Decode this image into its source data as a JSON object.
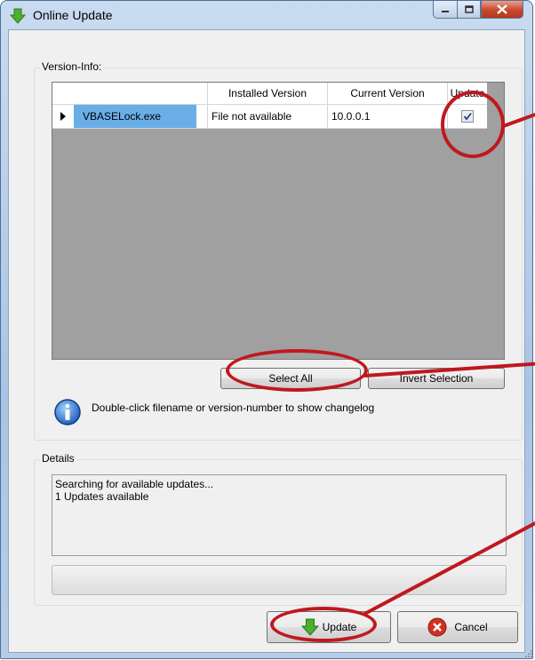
{
  "window": {
    "title": "Online Update",
    "title_icon": "green-down-arrow-icon",
    "caption_buttons": [
      "minimize-icon",
      "maximize-icon",
      "close-icon"
    ]
  },
  "version_info": {
    "group_label": "Version-Info:",
    "columns": [
      "Installed Version",
      "Current Version",
      "Update"
    ],
    "rows": [
      {
        "filename": "VBASELock.exe",
        "installed": "File not available",
        "current": "10.0.0.1",
        "update_checked": true
      }
    ],
    "buttons": {
      "select_all": "Select All",
      "invert_selection": "Invert Selection"
    },
    "hint": "Double-click filename or version-number to show changelog",
    "hint_icon": "info-icon"
  },
  "details": {
    "group_label": "Details",
    "log_lines": [
      "Searching for available updates...",
      "1 Updates available"
    ]
  },
  "footer": {
    "update_button": "Update",
    "update_icon": "green-down-arrow-icon",
    "cancel_button": "Cancel",
    "cancel_icon": "red-x-icon"
  },
  "colors": {
    "selection": "#6aaee8",
    "annotation": "#c0181f",
    "grid_background": "#a0a0a0"
  }
}
